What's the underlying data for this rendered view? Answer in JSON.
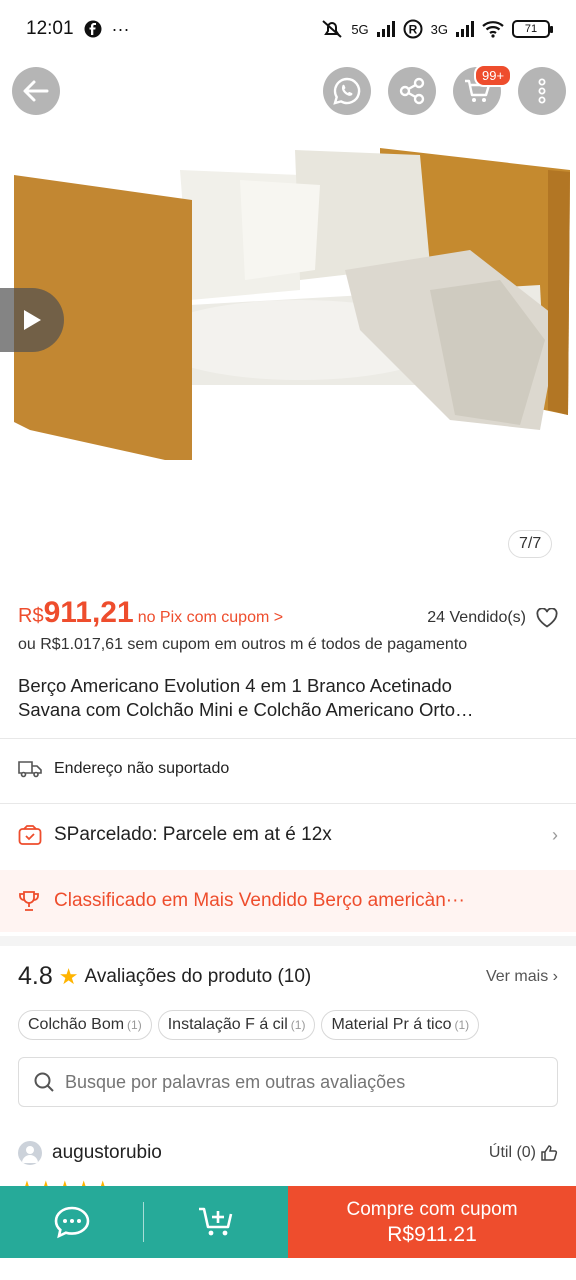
{
  "status_bar": {
    "time": "12:01",
    "signal_1": "5G",
    "signal_2": "3G",
    "battery": "71"
  },
  "gallery": {
    "counter": "7/7",
    "cart_badge": "99+"
  },
  "price": {
    "currency": "R$",
    "value": "911,21",
    "pix_label": "no Pix com cupom >",
    "sold": "24 Vendido(s)",
    "alt_price": "ou R$1.017,61 sem cupom em outros m é todos de pagamento"
  },
  "product": {
    "title_line1": "Berço Americano Evolution 4 em 1 Branco Acetinado",
    "title_line2": "Savana com Colchão Mini e Colchão Americano Orto…"
  },
  "shipping": {
    "label": "Endereço não suportado"
  },
  "installments": {
    "label": "SParcelado: Parcele em at é  12x"
  },
  "ranking": {
    "label": "Classificado em Mais Vendido Berço americàn···"
  },
  "reviews": {
    "rating": "4.8",
    "title": "Avaliações do produto (10)",
    "see_more": "Ver mais",
    "tags": [
      {
        "label": "Colchão Bom",
        "count": "(1)"
      },
      {
        "label": "Instalação F á cil",
        "count": "(1)"
      },
      {
        "label": "Material Pr á tico",
        "count": "(1)"
      }
    ],
    "search_placeholder": "Busque por palavras em outras avaliações",
    "first_reviewer": "augustorubio",
    "useful": "Útil (0)"
  },
  "bottom_bar": {
    "buy_label": "Compre com cupom",
    "buy_amount": "R$911.21"
  },
  "colors": {
    "accent": "#ee4d2d",
    "teal": "#26aa99",
    "star": "#ffb400"
  }
}
